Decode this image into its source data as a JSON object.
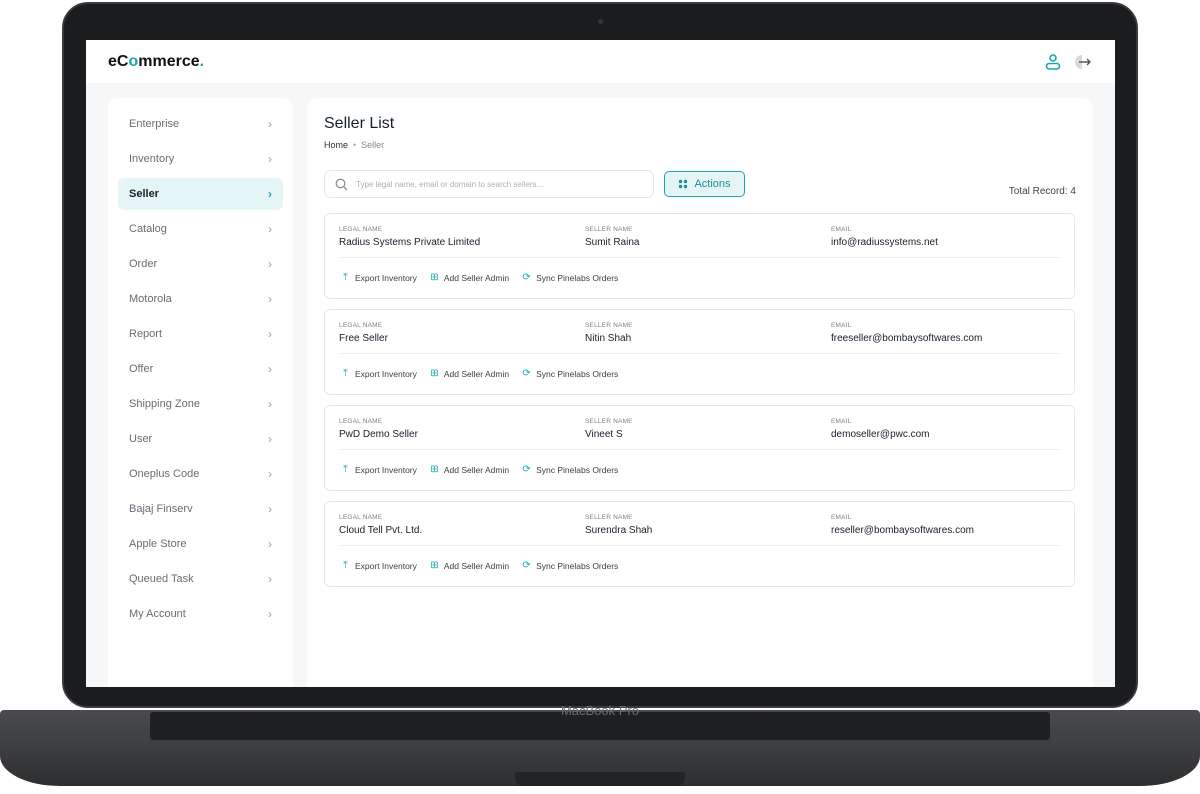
{
  "device_label": "MacBook Pro",
  "brand": {
    "prefix": "eC",
    "o": "o",
    "suffix": "mmerce",
    "dot": "."
  },
  "colors": {
    "accent": "#1aa5b0"
  },
  "header": {
    "user_icon": "user-icon",
    "logout_icon": "logout-icon"
  },
  "sidebar": {
    "items": [
      {
        "label": "Enterprise"
      },
      {
        "label": "Inventory"
      },
      {
        "label": "Seller",
        "active": true
      },
      {
        "label": "Catalog"
      },
      {
        "label": "Order"
      },
      {
        "label": "Motorola"
      },
      {
        "label": "Report"
      },
      {
        "label": "Offer"
      },
      {
        "label": "Shipping Zone"
      },
      {
        "label": "User"
      },
      {
        "label": "Oneplus Code"
      },
      {
        "label": "Bajaj Finserv"
      },
      {
        "label": "Apple Store"
      },
      {
        "label": "Queued Task"
      },
      {
        "label": "My Account"
      }
    ]
  },
  "main": {
    "title": "Seller List",
    "breadcrumb": {
      "home": "Home",
      "current": "Seller"
    },
    "search": {
      "placeholder": "Type legal name, email or domain to search sellers...",
      "value": ""
    },
    "actions_label": "Actions",
    "total_record": "Total Record: 4",
    "labels": {
      "legal": "Legal Name",
      "seller": "Seller Name",
      "email": "Email"
    },
    "row_actions": {
      "export": "Export Inventory",
      "add_admin": "Add Seller Admin",
      "sync": "Sync Pinelabs Orders"
    },
    "sellers": [
      {
        "legal": "Radius Systems Private Limited",
        "seller": "Sumit Raina",
        "email": "info@radiussystems.net"
      },
      {
        "legal": "Free Seller",
        "seller": "Nitin Shah",
        "email": "freeseller@bombaysoftwares.com"
      },
      {
        "legal": "PwD Demo Seller",
        "seller": "Vineet S",
        "email": "demoseller@pwc.com"
      },
      {
        "legal": "Cloud Tell Pvt. Ltd.",
        "seller": "Surendra Shah",
        "email": "reseller@bombaysoftwares.com"
      }
    ]
  }
}
